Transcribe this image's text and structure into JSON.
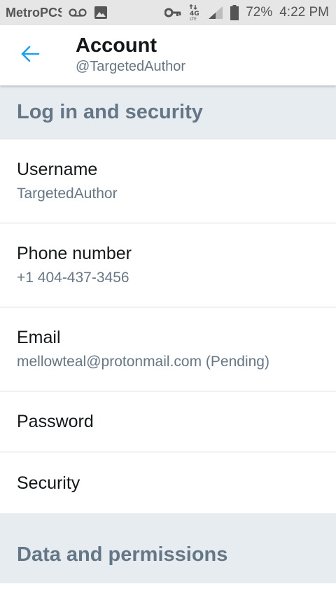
{
  "status_bar": {
    "carrier": "MetroPCS",
    "battery": "72%",
    "time": "4:22 PM",
    "icons": [
      "voicemail-icon",
      "image-icon",
      "vpn-key-icon",
      "lte-icon",
      "signal-icon",
      "battery-icon"
    ]
  },
  "header": {
    "title": "Account",
    "subtitle": "@TargetedAuthor",
    "back_icon": "back-arrow-icon",
    "accent_color": "#1da1f2"
  },
  "sections": {
    "login_security": {
      "title": "Log in and security",
      "rows": {
        "username": {
          "label": "Username",
          "value": "TargetedAuthor"
        },
        "phone": {
          "label": "Phone number",
          "value": "+1 404-437-3456"
        },
        "email": {
          "label": "Email",
          "value": "mellowteal@protonmail.com (Pending)"
        },
        "password": {
          "label": "Password"
        },
        "security": {
          "label": "Security"
        }
      }
    },
    "data_permissions": {
      "title": "Data and permissions"
    }
  },
  "colors": {
    "section_bg": "#e6ecf0",
    "section_text": "#657786",
    "primary_text": "#14171a",
    "secondary_text": "#657786"
  }
}
